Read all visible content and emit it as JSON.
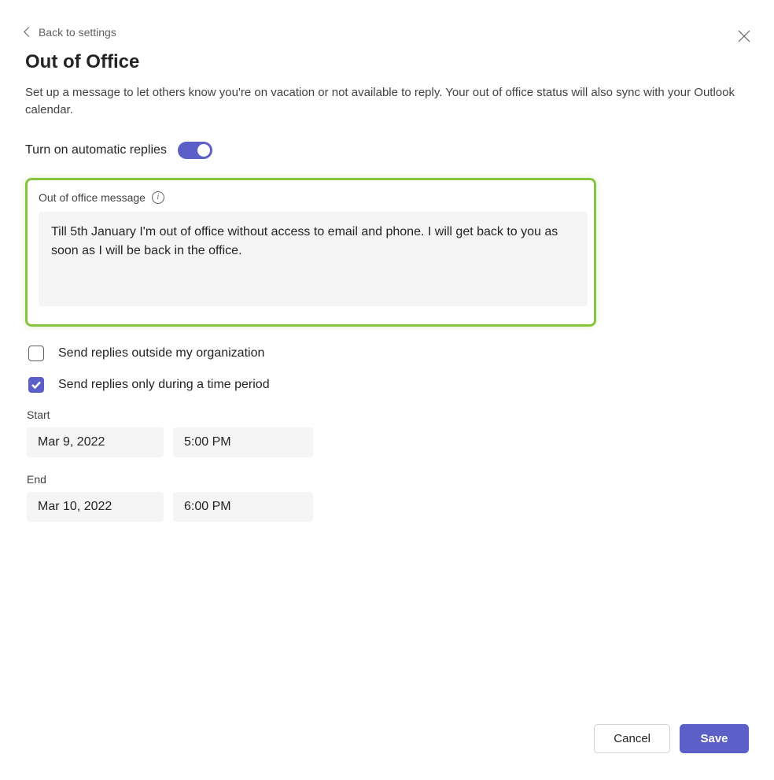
{
  "header": {
    "back_label": "Back to settings",
    "title": "Out of Office",
    "description": "Set up a message to let others know you're on vacation or not available to reply. Your out of office status will also sync with your Outlook calendar."
  },
  "toggle": {
    "label": "Turn on automatic replies",
    "enabled": true
  },
  "message": {
    "label": "Out of office message",
    "value": "Till 5th January I'm out of office without access to email and phone. I will get back to you as soon as I will be back in the office."
  },
  "options": {
    "send_outside_label": "Send replies outside my organization",
    "send_outside_checked": false,
    "time_period_label": "Send replies only during a time period",
    "time_period_checked": true
  },
  "schedule": {
    "start_label": "Start",
    "start_date": "Mar 9, 2022",
    "start_time": "5:00 PM",
    "end_label": "End",
    "end_date": "Mar 10, 2022",
    "end_time": "6:00 PM"
  },
  "footer": {
    "cancel_label": "Cancel",
    "save_label": "Save"
  }
}
